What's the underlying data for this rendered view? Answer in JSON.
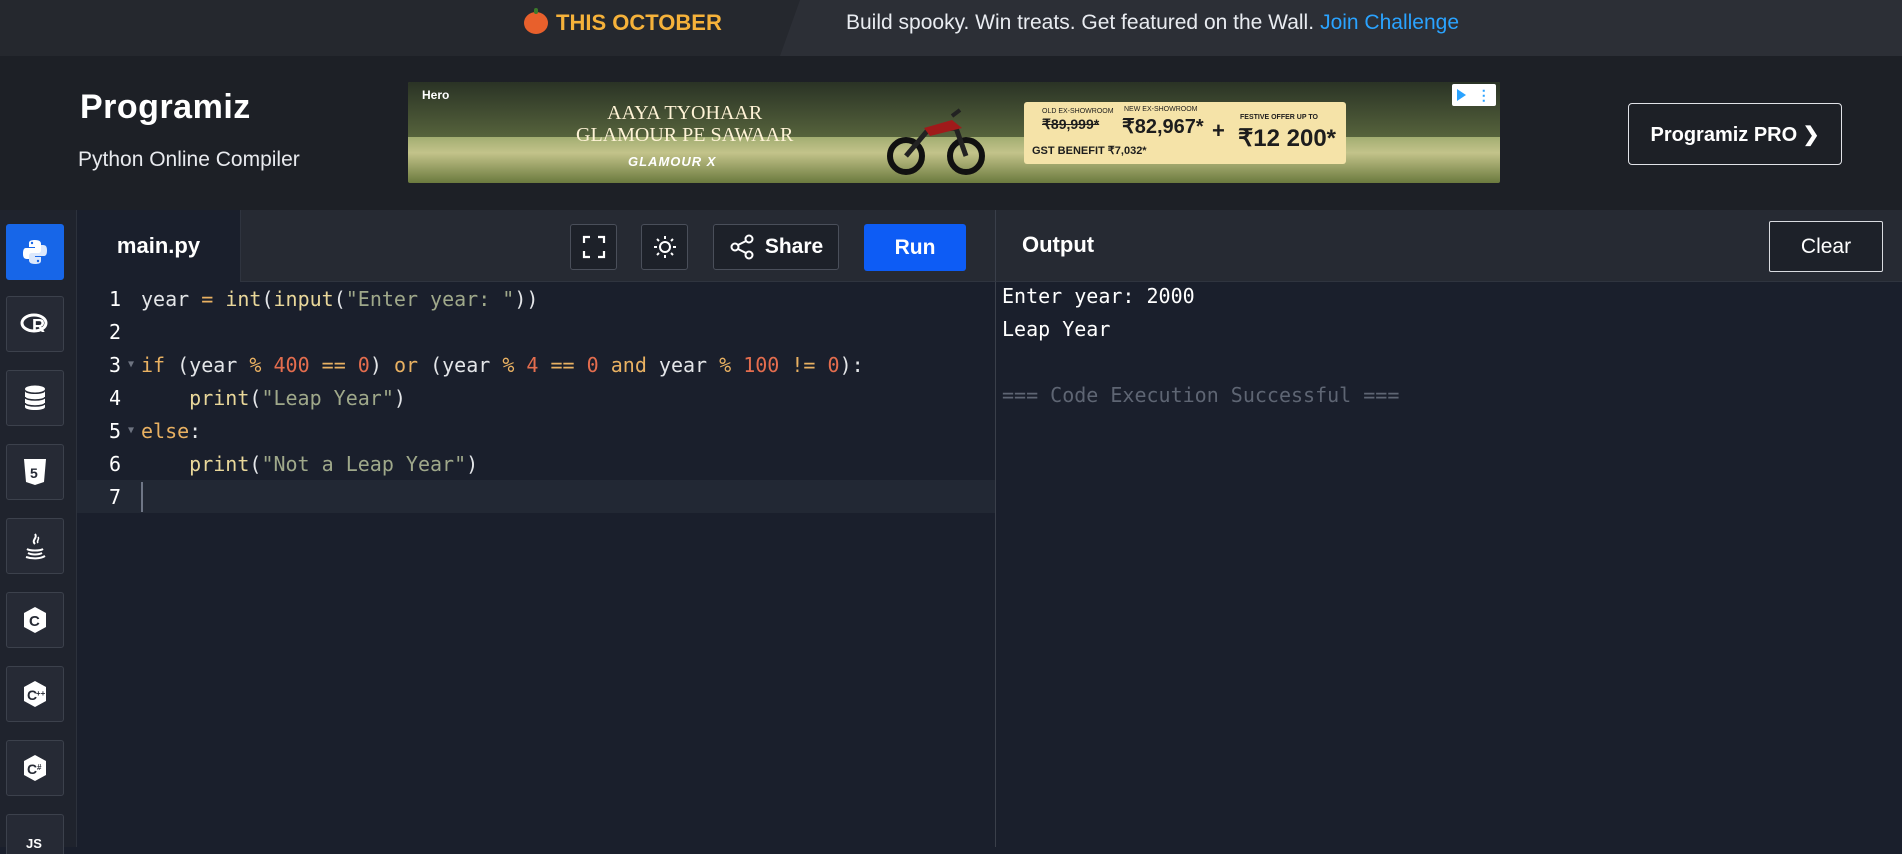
{
  "promo": {
    "tag": "THIS OCTOBER",
    "text": "Build spooky. Win treats. Get featured on the Wall.",
    "link": "Join Challenge"
  },
  "header": {
    "logo": "Programiz",
    "subtitle": "Python Online Compiler",
    "pro_button": "Programiz PRO ❯"
  },
  "ad": {
    "brand": "Hero",
    "title_line1": "AAYA TYOHAAR",
    "title_line2": "GLAMOUR PE SAWAAR",
    "model": "GLAMOUR X",
    "old_label": "OLD EX-SHOWROOM",
    "old_price": "₹89,999*",
    "new_label": "NEW EX-SHOWROOM",
    "new_price": "₹82,967*",
    "gst": "GST BENEFIT ₹7,032*",
    "plus": "+",
    "festive_label": "FESTIVE OFFER UP TO",
    "festive_price": "₹12 200*"
  },
  "languages": [
    "python-icon",
    "r-icon",
    "sql-icon",
    "html5-icon",
    "java-icon",
    "c-icon",
    "cpp-icon",
    "csharp-icon",
    "js-icon"
  ],
  "toolbar": {
    "file_tab": "main.py",
    "share_label": "Share",
    "run_label": "Run"
  },
  "editor": {
    "line_numbers": [
      "1",
      "2",
      "3",
      "4",
      "5",
      "6",
      "7"
    ],
    "lines": [
      "year = int(input(\"Enter year: \"))",
      "",
      "if (year % 400 == 0) or (year % 4 == 0 and year % 100 != 0):",
      "    print(\"Leap Year\")",
      "else:",
      "    print(\"Not a Leap Year\")",
      ""
    ]
  },
  "output": {
    "title": "Output",
    "clear_label": "Clear",
    "lines": [
      "Enter year: 2000",
      "Leap Year",
      "",
      "=== Code Execution Successful ==="
    ]
  },
  "colors": {
    "run": "#0d5cf5",
    "active_lang": "#1766e8",
    "promo_tag": "#f6b23a",
    "promo_link": "#2aa3ff",
    "editor_bg": "#1a1f2c"
  }
}
